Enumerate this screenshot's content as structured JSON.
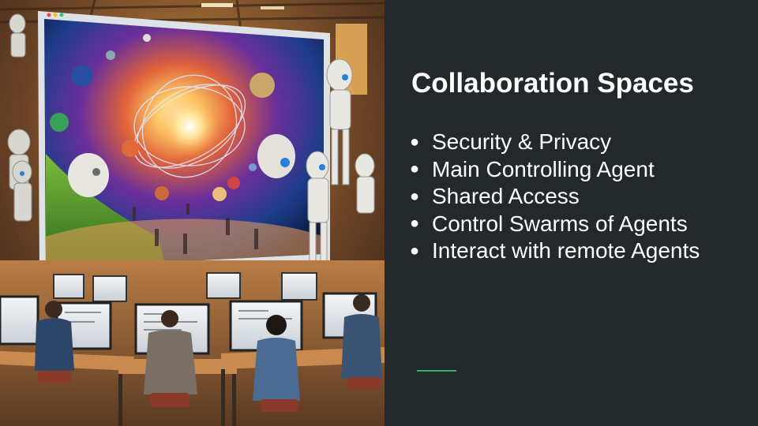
{
  "slide": {
    "title": "Collaboration Spaces",
    "bullets": [
      "Security & Privacy",
      "Main Controlling Agent",
      "Shared Access",
      "Control Swarms of Agents",
      "Interact with remote Agents"
    ],
    "bullet_glyph": "●"
  },
  "colors": {
    "background": "#23282a",
    "text": "#ffffff",
    "accent": "#28b46b"
  },
  "illustration": {
    "description_icons": [
      "screen-icon",
      "robot-icon",
      "planet-icon",
      "person-icon",
      "monitor-icon"
    ]
  }
}
